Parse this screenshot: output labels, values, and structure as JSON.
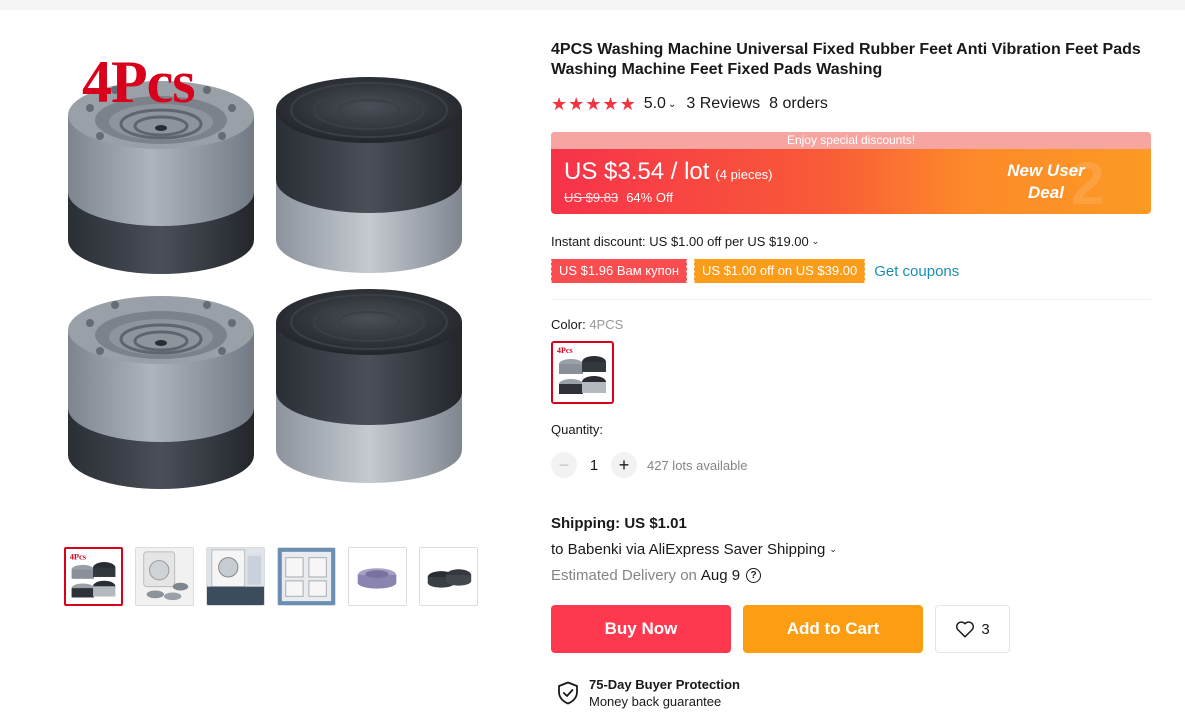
{
  "gallery": {
    "brand_overlay": "4Pcs",
    "thumbnail_count": 6
  },
  "product": {
    "title": "4PCS Washing Machine Universal Fixed Rubber Feet Anti Vibration Feet Pads Washing Machine Feet Fixed Pads Washing"
  },
  "rating": {
    "stars": 5,
    "value": "5.0",
    "reviews": "3 Reviews",
    "orders": "8 orders"
  },
  "price": {
    "promo_strip": "Enjoy special discounts!",
    "amount": "US $3.54 / lot",
    "pieces": "(4 pieces)",
    "original": "US $9.83",
    "discount": "64% Off",
    "deal_line1": "New User",
    "deal_line2": "Deal"
  },
  "discount": {
    "instant": "Instant discount: US $1.00 off per US $19.00",
    "coupon_red": "US $1.96 Вам купон",
    "coupon_orange": "US $1.00 off on US $39.00",
    "get_coupons": "Get coupons"
  },
  "variant": {
    "color_label": "Color:",
    "color_value": "4PCS"
  },
  "quantity": {
    "label": "Quantity:",
    "value": "1",
    "minus": "−",
    "plus": "+",
    "available": "427 lots available"
  },
  "shipping": {
    "title": "Shipping: US $1.01",
    "destination": "to Babenki via AliExpress Saver Shipping",
    "delivery_prefix": "Estimated Delivery on",
    "delivery_date": "Aug 9",
    "help": "?"
  },
  "actions": {
    "buy_now": "Buy Now",
    "add_to_cart": "Add to Cart",
    "wishlist_count": "3"
  },
  "protection": {
    "title": "75-Day Buyer Protection",
    "subtitle": "Money back guarantee"
  },
  "colors": {
    "accent_red": "#fd384f",
    "accent_orange": "#fd9e12",
    "link": "#1a8fb0",
    "star": "#f23340"
  }
}
